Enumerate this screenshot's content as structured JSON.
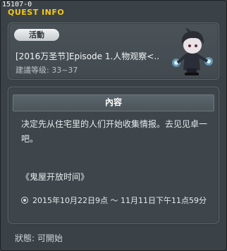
{
  "window": {
    "quest_id": "15107-0",
    "title": "QUEST INFO",
    "close_label": "×"
  },
  "quest": {
    "category": "活動",
    "title": "[2016万圣节]Episode 1.人物观察<..",
    "level": "建議等级: 33~37"
  },
  "detail": {
    "header": "內容",
    "description": "决定先从住宅里的人们开始收集情报。去见见卓一吧。",
    "link_text": "《鬼屋开放时间》",
    "time_text": "2015年10月22日9点 ～ 11月11日下午11点59分"
  },
  "status": {
    "text": "狀態: 可開始"
  },
  "colors": {
    "title_accent": "#f4c81a",
    "panel_border": "#5f686d",
    "background": "#3b4247"
  }
}
